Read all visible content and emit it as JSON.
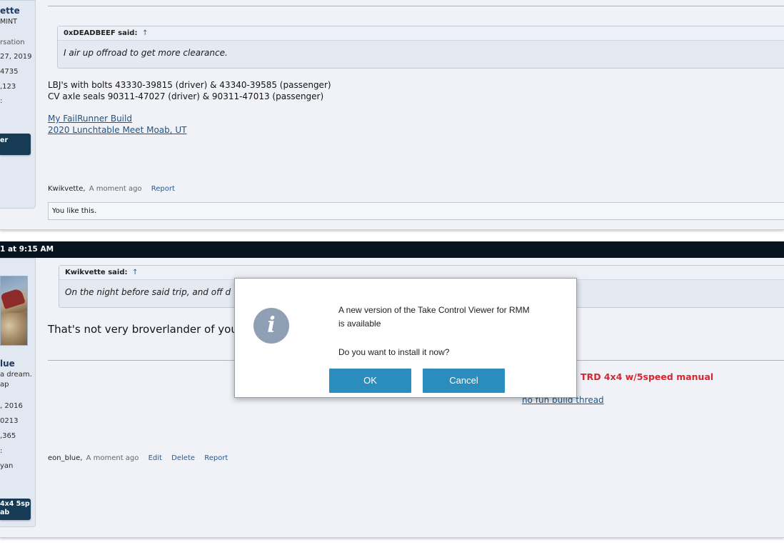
{
  "post1": {
    "user": {
      "name_fragment": "ette",
      "title_fragment": "MINT",
      "stats": [
        "rsation",
        "27, 2019",
        "4735",
        ",123",
        ":"
      ],
      "badge": "er"
    },
    "quote": {
      "author": "0xDEADBEEF said:",
      "arrow": "↑",
      "text": "I air up offroad to get more clearance."
    },
    "body_lines": [
      "LBJ's with bolts 43330-39815 (driver) & 43340-39585 (passenger)",
      "CV axle seals 90311-47027 (driver) & 90311-47013 (passenger)"
    ],
    "signature_links": [
      "My FailRunner Build",
      "2020 Lunchtable Meet Moab, UT"
    ],
    "meta": {
      "author": "Kwikvette,",
      "time": "A moment ago",
      "report": "Report"
    },
    "likes": "You like this."
  },
  "divider": {
    "date_text": "1 at 9:15 AM"
  },
  "post2": {
    "user": {
      "name_fragment": "lue",
      "title_lines": [
        "a dream.",
        "ap"
      ],
      "stats": [
        ", 2016",
        "0213",
        ",365",
        ":",
        "yan"
      ],
      "badge_lines": [
        "4x4 5sp",
        "ab"
      ]
    },
    "quote": {
      "author": "Kwikvette said:",
      "arrow": "↑",
      "text": "On the night before said trip, and off d"
    },
    "body": "That's not very broverlander of you",
    "sig_red": "5 TRD 4x4 w/5speed manual",
    "sig_link": "no fun build thread",
    "meta": {
      "author": "eon_blue,",
      "time": "A moment ago",
      "edit": "Edit",
      "delete": "Delete",
      "report": "Report"
    }
  },
  "dialog": {
    "icon": "info-icon",
    "icon_glyph": "i",
    "line1": "A new version of the Take Control Viewer for RMM",
    "line2": "is available",
    "question": "Do you want to install it now?",
    "ok": "OK",
    "cancel": "Cancel"
  }
}
